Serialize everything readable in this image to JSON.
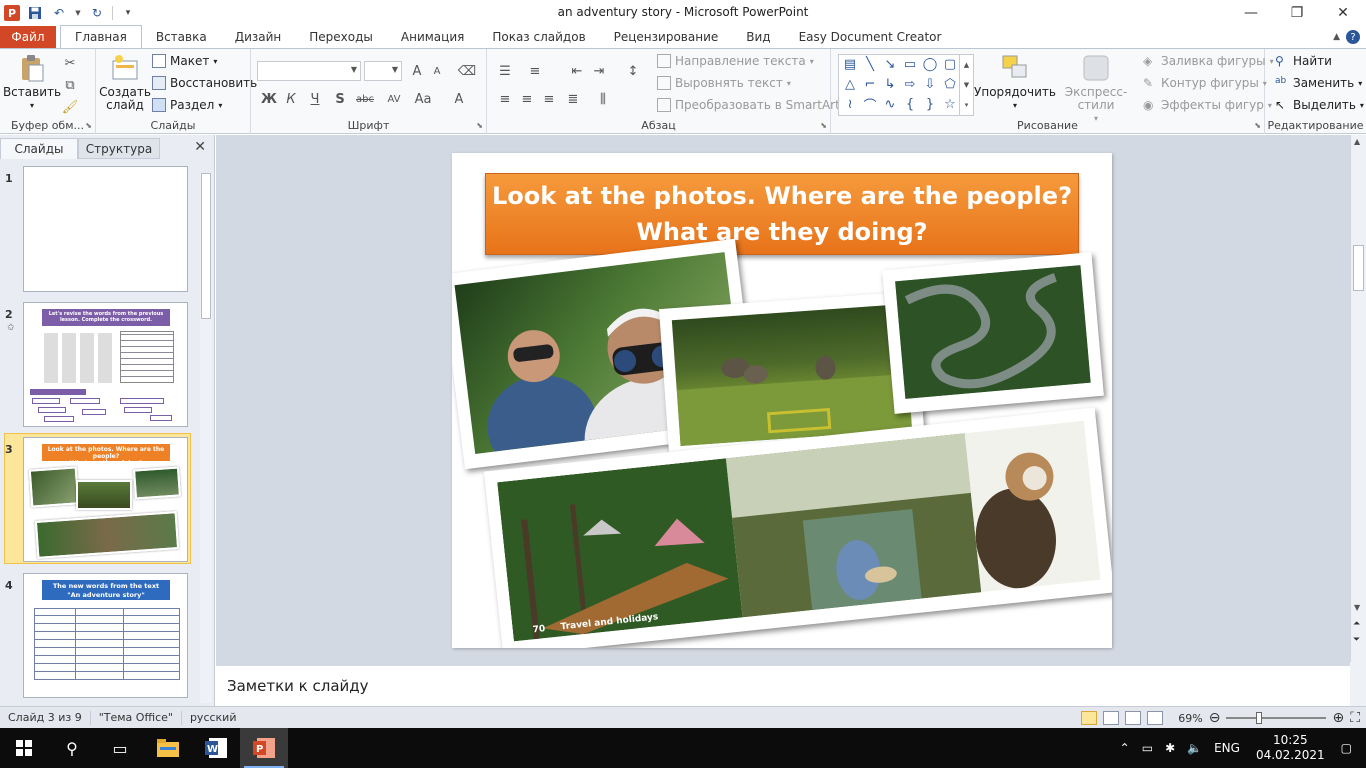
{
  "window": {
    "title": "an adventury story  -  Microsoft PowerPoint",
    "min_glyph": "—",
    "restore_glyph": "❐",
    "close_glyph": "✕"
  },
  "quick_access": {
    "logo": "P"
  },
  "tabs": {
    "file": "Файл",
    "items": [
      "Главная",
      "Вставка",
      "Дизайн",
      "Переходы",
      "Анимация",
      "Показ слайдов",
      "Рецензирование",
      "Вид",
      "Easy Document Creator"
    ],
    "active": "Главная"
  },
  "ribbon": {
    "clipboard": {
      "label": "Буфер обм...",
      "paste": "Вставить"
    },
    "slides": {
      "label": "Слайды",
      "new_slide_1": "Создать",
      "new_slide_2": "слайд",
      "layout": "Макет",
      "reset": "Восстановить",
      "section": "Раздел"
    },
    "font": {
      "label": "Шрифт",
      "bold": "Ж",
      "italic": "К",
      "underline": "Ч",
      "shadow": "S",
      "strike": "abc",
      "spacing": "AV",
      "case": "Aa",
      "color": "A",
      "grow": "A",
      "shrink": "A"
    },
    "paragraph": {
      "label": "Абзац",
      "text_direction": "Направление текста",
      "align_text": "Выровнять текст",
      "smartart": "Преобразовать в SmartArt"
    },
    "drawing": {
      "label": "Рисование",
      "arrange": "Упорядочить",
      "quick_styles": "Экспресс-стили",
      "fill": "Заливка фигуры",
      "outline": "Контур фигуры",
      "effects": "Эффекты фигур"
    },
    "editing": {
      "label": "Редактирование",
      "find": "Найти",
      "replace": "Заменить",
      "select": "Выделить"
    }
  },
  "left_panel": {
    "tab_slides": "Слайды",
    "tab_outline": "Структура",
    "thumbs": [
      {
        "num": "1"
      },
      {
        "num": "2",
        "title": "Let's revise the words from the previous lesson. Complete the crossword."
      },
      {
        "num": "3",
        "title_1": "Look at the photos. Where are the people?",
        "title_2": "What are they doing?"
      },
      {
        "num": "4",
        "title_1": "The new words from the text",
        "title_2": "\"An adventure story\""
      }
    ]
  },
  "slide": {
    "title_line1": "Look at the photos. Where are the people?",
    "title_line2": "What are they doing?",
    "caption_num": "70",
    "caption_text": "Travel and holidays",
    "colors": {
      "title_bg": "#ee8126",
      "title_text": "#ffffff"
    }
  },
  "notes": {
    "placeholder": "Заметки к слайду"
  },
  "status": {
    "slide_info": "Слайд 3 из 9",
    "theme": "\"Тема Office\"",
    "language": "русский",
    "zoom": "69%",
    "zoom_level": 0.69
  },
  "taskbar": {
    "lang": "ENG",
    "time": "10:25",
    "date": "04.02.2021"
  }
}
